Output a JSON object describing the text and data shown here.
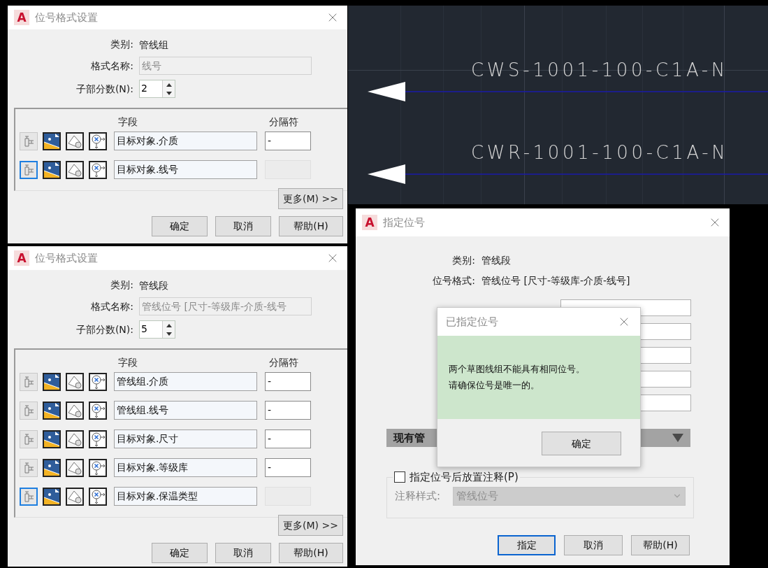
{
  "format_dialogs": [
    {
      "logo": "A",
      "title": "位号格式设置",
      "category_label": "类别:",
      "category": "管线组",
      "name_label": "格式名称:",
      "name_value": "线号",
      "count_label": "子部分数(N):",
      "count": "2",
      "field_header": "字段",
      "separator_header": "分隔符",
      "rows": [
        {
          "field": "目标对象.介质",
          "selected": false,
          "separator": "-",
          "separator_disabled": false
        },
        {
          "field": "目标对象.线号",
          "selected": true,
          "separator_disabled": true
        }
      ],
      "more_button": "更多(M) >>",
      "buttons": [
        {
          "label": "确定",
          "default": false
        },
        {
          "label": "取消",
          "default": false
        },
        {
          "label": "帮助(H)",
          "default": false
        }
      ]
    },
    {
      "logo": "A",
      "title": "位号格式设置",
      "category_label": "类别:",
      "category": "管线段",
      "name_label": "格式名称:",
      "name_value": "管线位号 [尺寸-等级库-介质-线号",
      "count_label": "子部分数(N):",
      "count": "5",
      "field_header": "字段",
      "separator_header": "分隔符",
      "rows": [
        {
          "field": "管线组.介质",
          "selected": false,
          "separator": "-",
          "separator_disabled": false
        },
        {
          "field": "管线组.线号",
          "selected": false,
          "separator": "-",
          "separator_disabled": false
        },
        {
          "field": "目标对象.尺寸",
          "selected": false,
          "separator": "-",
          "separator_disabled": false
        },
        {
          "field": "目标对象.等级库",
          "selected": false,
          "separator": "-",
          "separator_disabled": false
        },
        {
          "field": "目标对象.保温类型",
          "selected": true,
          "separator_disabled": true
        }
      ],
      "more_button": "更多(M) >>",
      "buttons": [
        {
          "label": "确定",
          "default": false
        },
        {
          "label": "取消",
          "default": false
        },
        {
          "label": "帮助(H)",
          "default": false
        }
      ]
    }
  ],
  "drawing_canvas": {
    "labels": [
      {
        "text": "CWS-1001-100-C1A-N"
      },
      {
        "text": "CWR-1001-100-C1A-N"
      }
    ]
  },
  "assign_dialog": {
    "logo": "A",
    "title": "指定位号",
    "category_label": "类别:",
    "category": "管线段",
    "format_label": "位号格式:",
    "format": "管线位号 [尺寸-等级库-介质-线号]",
    "section_title": "现有管",
    "annotate": {
      "label": "指定位号后放置注释(P)",
      "checked": false
    },
    "style_label": "注释样式:",
    "style_value": "管线位号",
    "buttons": [
      {
        "label": "指定",
        "default": true
      },
      {
        "label": "取消",
        "default": false
      },
      {
        "label": "帮助(H)",
        "default": false
      }
    ]
  },
  "message_box": {
    "title": "已指定位号",
    "lines": [
      "两个草图线组不能具有相同位号。",
      "请确保位号是唯一的。"
    ],
    "button": "确定"
  }
}
